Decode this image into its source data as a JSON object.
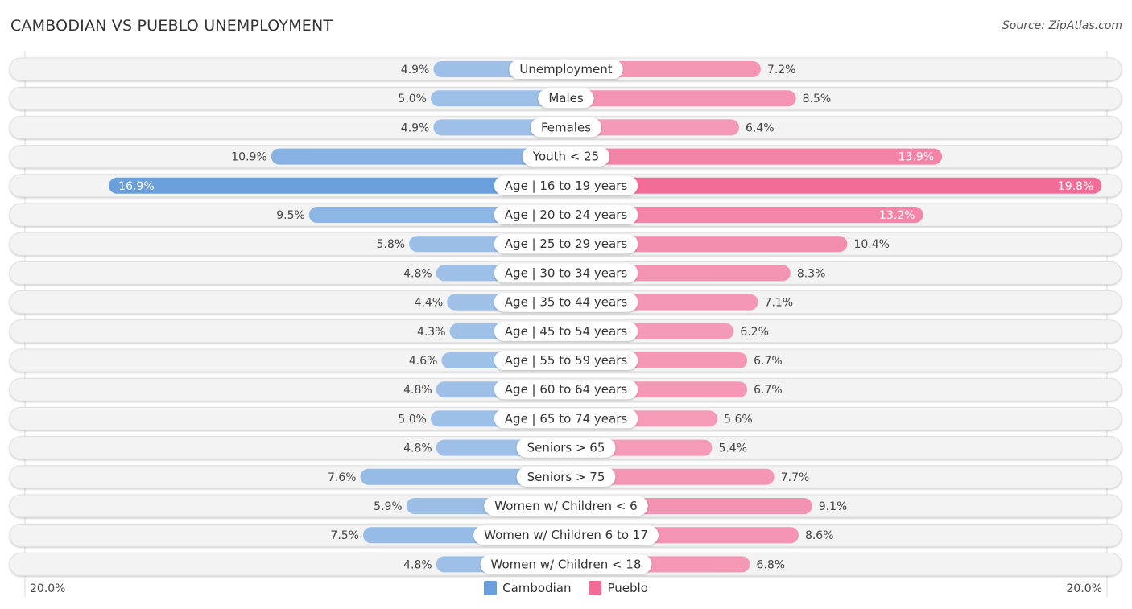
{
  "header": {
    "title": "CAMBODIAN VS PUEBLO UNEMPLOYMENT",
    "source": "Source: ZipAtlas.com"
  },
  "colors": {
    "cambodian": "#6a9fdc",
    "cambodian_light": "#a7c6ea",
    "pueblo": "#f26b96",
    "pueblo_light": "#f5a3be"
  },
  "chart_data": {
    "type": "bar",
    "orientation": "horizontal-diverging",
    "title": "CAMBODIAN VS PUEBLO UNEMPLOYMENT",
    "xlabel": "",
    "ylabel": "",
    "xlim": [
      -20,
      20
    ],
    "axis_tick_labels": {
      "left": "20.0%",
      "right": "20.0%"
    },
    "legend_position": "bottom-center",
    "categories": [
      "Unemployment",
      "Males",
      "Females",
      "Youth < 25",
      "Age | 16 to 19 years",
      "Age | 20 to 24 years",
      "Age | 25 to 29 years",
      "Age | 30 to 34 years",
      "Age | 35 to 44 years",
      "Age | 45 to 54 years",
      "Age | 55 to 59 years",
      "Age | 60 to 64 years",
      "Age | 65 to 74 years",
      "Seniors > 65",
      "Seniors > 75",
      "Women w/ Children < 6",
      "Women w/ Children 6 to 17",
      "Women w/ Children < 18"
    ],
    "series": [
      {
        "name": "Cambodian",
        "side": "left",
        "values": [
          4.9,
          5.0,
          4.9,
          10.9,
          16.9,
          9.5,
          5.8,
          4.8,
          4.4,
          4.3,
          4.6,
          4.8,
          5.0,
          4.8,
          7.6,
          5.9,
          7.5,
          4.8
        ],
        "labels": [
          "4.9%",
          "5.0%",
          "4.9%",
          "10.9%",
          "16.9%",
          "9.5%",
          "5.8%",
          "4.8%",
          "4.4%",
          "4.3%",
          "4.6%",
          "4.8%",
          "5.0%",
          "4.8%",
          "7.6%",
          "5.9%",
          "7.5%",
          "4.8%"
        ]
      },
      {
        "name": "Pueblo",
        "side": "right",
        "values": [
          7.2,
          8.5,
          6.4,
          13.9,
          19.8,
          13.2,
          10.4,
          8.3,
          7.1,
          6.2,
          6.7,
          6.7,
          5.6,
          5.4,
          7.7,
          9.1,
          8.6,
          6.8
        ],
        "labels": [
          "7.2%",
          "8.5%",
          "6.4%",
          "13.9%",
          "19.8%",
          "13.2%",
          "10.4%",
          "8.3%",
          "7.1%",
          "6.2%",
          "6.7%",
          "6.7%",
          "5.6%",
          "5.4%",
          "7.7%",
          "9.1%",
          "8.6%",
          "6.8%"
        ]
      }
    ]
  },
  "legend": {
    "items": [
      {
        "label": "Cambodian"
      },
      {
        "label": "Pueblo"
      }
    ]
  }
}
